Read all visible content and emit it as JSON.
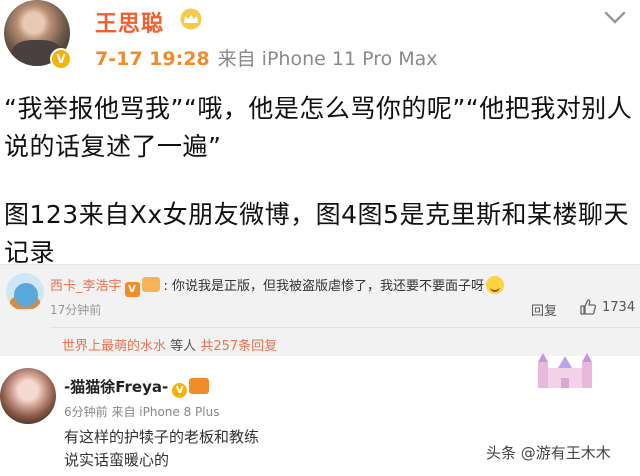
{
  "post": {
    "username": "王思聪",
    "time": "7-17 19:28",
    "source": "来自 iPhone 11 Pro Max",
    "text1": "“我举报他骂我”“哦，他是怎么骂你的呢”“他把我对别人说的话复述了一遍”",
    "text2": "图123来自Xx女朋友微博，图4图5是克里斯和某楼聊天记录",
    "verified_badge": "V"
  },
  "comment": {
    "username": "西卡_李浩宇",
    "badge": "V",
    "text": "你说我是正版，但我被盗版虐惨了，我还要不要面子呀",
    "time": "17分钟前",
    "reply_label": "回复",
    "likes": "1734",
    "sub_reply": {
      "nick": "世界上最萌的水水",
      "mid": "等人",
      "count": "共257条回复"
    }
  },
  "comment2": {
    "username": "-猫猫徐Freya-",
    "badge": "V",
    "meta": "6分钟前 来自 iPhone 8 Plus",
    "line1": "有这样的护犊子的老板和教练",
    "line2": "说实话蛮暖心的"
  },
  "watermark": "头条 @游有王木木",
  "colors": {
    "username": "#f0602f",
    "accent": "#eb7350",
    "gold": "#f5b400"
  },
  "icons": [
    "crown-icon",
    "chevron-down-icon",
    "like-icon",
    "castle-icon"
  ]
}
